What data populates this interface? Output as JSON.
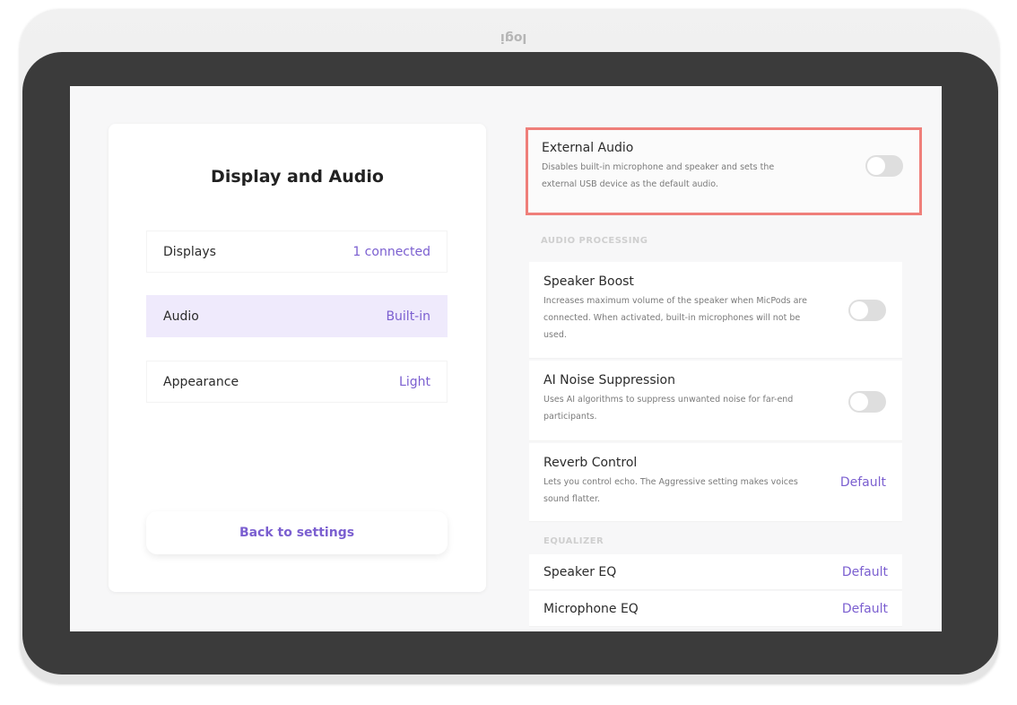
{
  "device": {
    "logo": "logi"
  },
  "left": {
    "title": "Display and Audio",
    "items": [
      {
        "label": "Displays",
        "value": "1 connected"
      },
      {
        "label": "Audio",
        "value": "Built-in"
      },
      {
        "label": "Appearance",
        "value": "Light"
      }
    ],
    "back": "Back to settings"
  },
  "external": {
    "title": "External Audio",
    "desc": "Disables built-in microphone and speaker and sets the external USB device as the default audio.",
    "enabled": false
  },
  "audio_processing": {
    "header": "AUDIO PROCESSING",
    "speaker_boost": {
      "title": "Speaker Boost",
      "desc": "Increases maximum volume of the speaker when MicPods are connected. When activated, built-in microphones will not be used.",
      "enabled": false
    },
    "noise": {
      "title": "AI Noise Suppression",
      "desc": "Uses AI algorithms to suppress unwanted noise for far-end participants.",
      "enabled": false
    },
    "reverb": {
      "title": "Reverb Control",
      "desc": "Lets you control echo. The Aggressive setting makes voices sound flatter.",
      "value": "Default"
    }
  },
  "equalizer": {
    "header": "EQUALIZER",
    "speaker": {
      "label": "Speaker EQ",
      "value": "Default"
    },
    "mic": {
      "label": "Microphone EQ",
      "value": "Default"
    }
  },
  "colors": {
    "accent": "#7b5fd0",
    "highlight": "#ef7f7a",
    "selected": "#efeafc"
  }
}
